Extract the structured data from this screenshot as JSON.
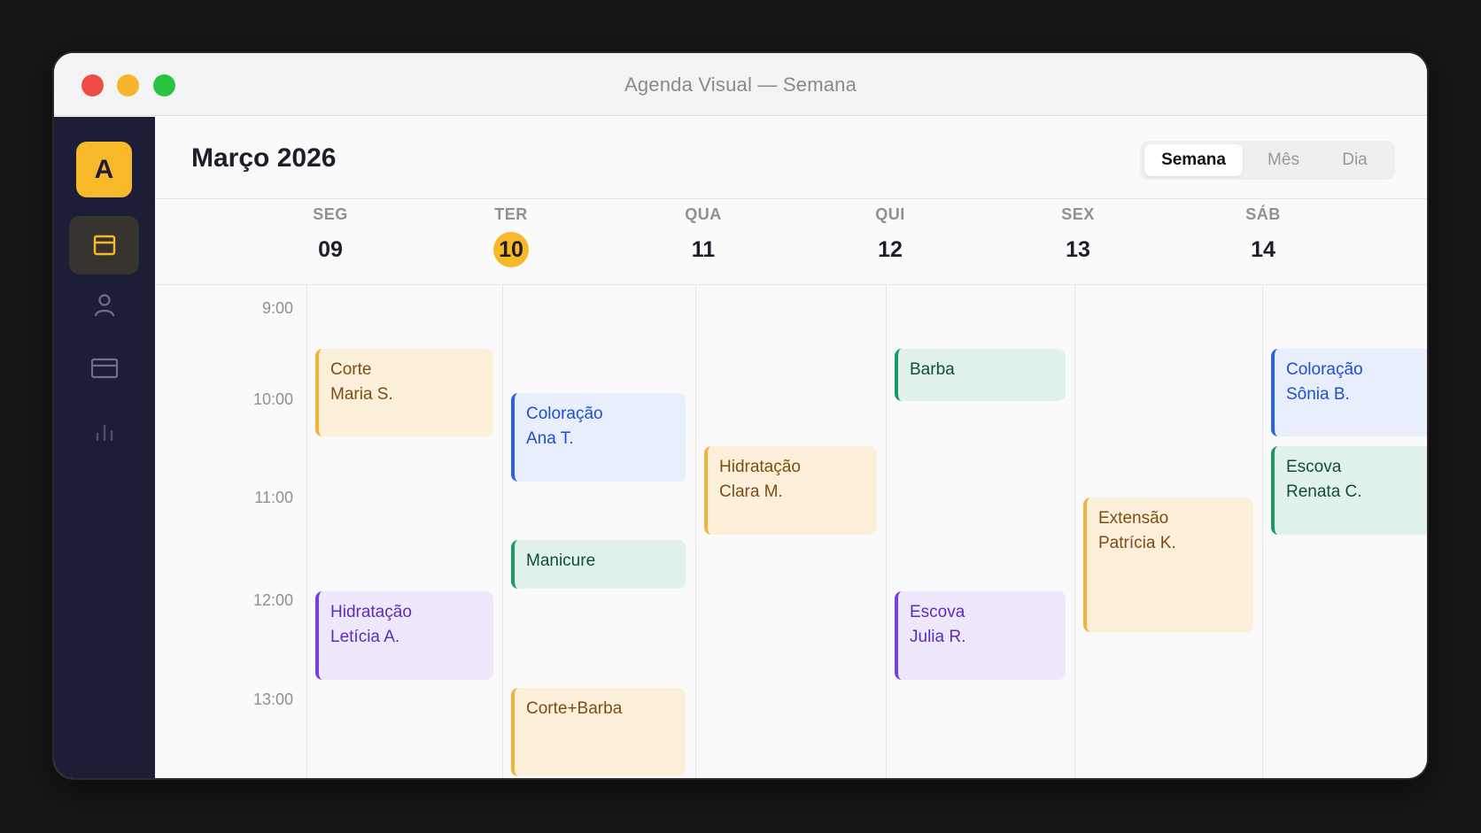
{
  "window": {
    "title": "Agenda Visual — Semana"
  },
  "sidebar": {
    "avatar_letter": "A",
    "nav": [
      {
        "icon": "calendar-icon",
        "active": true
      },
      {
        "icon": "user-icon",
        "active": false
      },
      {
        "icon": "credit-card-icon",
        "active": false
      },
      {
        "icon": "bar-chart-icon",
        "active": false
      }
    ]
  },
  "header": {
    "month": "Março 2026",
    "views": [
      "Semana",
      "Mês",
      "Dia"
    ],
    "selected_view": "Semana"
  },
  "days": [
    {
      "name": "SEG",
      "date": "09",
      "today": false
    },
    {
      "name": "TER",
      "date": "10",
      "today": true
    },
    {
      "name": "QUA",
      "date": "11",
      "today": false
    },
    {
      "name": "QUI",
      "date": "12",
      "today": false
    },
    {
      "name": "SEX",
      "date": "13",
      "today": false
    },
    {
      "name": "SÁB",
      "date": "14",
      "today": false
    }
  ],
  "times": [
    "9:00",
    "10:00",
    "11:00",
    "12:00",
    "13:00"
  ],
  "events": [
    {
      "day": 0,
      "title": "Corte",
      "client": "Maria S.",
      "color": "orange"
    },
    {
      "day": 0,
      "title": "Hidratação",
      "client": "Letícia A.",
      "color": "purple"
    },
    {
      "day": 1,
      "title": "Coloração",
      "client": "Ana T.",
      "color": "blue"
    },
    {
      "day": 1,
      "title": "Manicure",
      "client": "",
      "color": "green"
    },
    {
      "day": 1,
      "title": "Corte+Barba",
      "client": "",
      "color": "orange"
    },
    {
      "day": 2,
      "title": "Hidratação",
      "client": "Clara M.",
      "color": "orange"
    },
    {
      "day": 3,
      "title": "Barba",
      "client": "",
      "color": "green"
    },
    {
      "day": 3,
      "title": "Escova",
      "client": "Julia R.",
      "color": "purple"
    },
    {
      "day": 4,
      "title": "Extensão",
      "client": "Patrícia K.",
      "color": "orange"
    },
    {
      "day": 5,
      "title": "Coloração",
      "client": "Sônia B.",
      "color": "blue"
    },
    {
      "day": 5,
      "title": "Escova",
      "client": "Renata C.",
      "color": "green"
    }
  ],
  "colors": {
    "accent": "#f7b82a",
    "sidebar_bg": "#1c1d36",
    "orange": "#f1b43a",
    "blue": "#2764e6",
    "green": "#1b9a64",
    "purple": "#7b3fe0"
  }
}
